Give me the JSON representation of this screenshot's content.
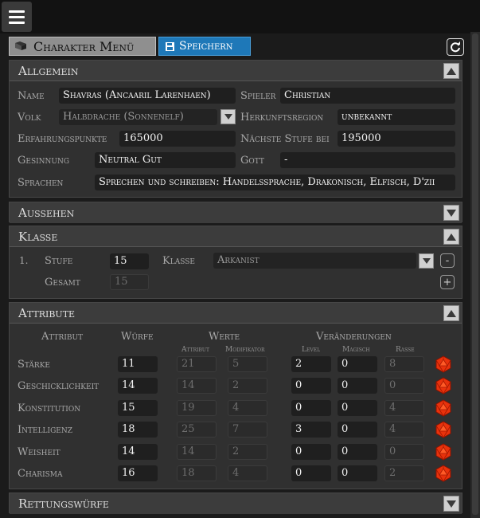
{
  "toolbar": {
    "menu_label": "Charakter Menü",
    "save_label": "Speichern",
    "menu_icon": "book-icon",
    "save_icon": "floppy-disk-icon",
    "refresh_icon": "refresh-icon"
  },
  "allgemein": {
    "title": "Allgemein",
    "name_label": "Name",
    "name_value": "Shavras (Ancaaril Larenhaen)",
    "spieler_label": "Spieler",
    "spieler_value": "Christian",
    "volk_label": "Volk",
    "volk_value": "Halbdrache (Sonnenelf)",
    "herkunft_label": "Herkunftsregion",
    "herkunft_value": "unbekannt",
    "ep_label": "Erfahrungspunkte",
    "ep_value": "165000",
    "next_label": "Nächste Stufe bei",
    "next_value": "195000",
    "gesinnung_label": "Gesinnung",
    "gesinnung_value": "Neutral Gut",
    "gott_label": "Gott",
    "gott_value": "-",
    "sprachen_label": "Sprachen",
    "sprachen_value": "Sprechen und schreiben: Handelssprache, Drakonisch, Elfisch, D'zii"
  },
  "aussehen": {
    "title": "Aussehen"
  },
  "klasse": {
    "title": "Klasse",
    "row_number": "1.",
    "stufe_label": "Stufe",
    "stufe_value": "15",
    "klasse_label": "Klasse",
    "klasse_value": "Arkanist",
    "gesamt_label": "Gesamt",
    "gesamt_value": "15",
    "remove_label": "-",
    "add_label": "+"
  },
  "attribute": {
    "title": "Attribute",
    "headers": {
      "attribut": "Attribut",
      "wuerfe": "Würfe",
      "werte": "Werte",
      "veraenderungen": "Veränderungen"
    },
    "subheaders": {
      "attribut": "Attribut",
      "modifikator": "Modifikator",
      "level": "Level",
      "magisch": "Magisch",
      "rasse": "Rasse"
    },
    "die_icon": "red-d20-die-icon",
    "rows": [
      {
        "name": "Stärke",
        "wuerfe": "11",
        "attribut": "21",
        "modifikator": "5",
        "level": "2",
        "magisch": "0",
        "rasse": "8"
      },
      {
        "name": "Geschicklichkeit",
        "wuerfe": "14",
        "attribut": "14",
        "modifikator": "2",
        "level": "0",
        "magisch": "0",
        "rasse": "0"
      },
      {
        "name": "Konstitution",
        "wuerfe": "15",
        "attribut": "19",
        "modifikator": "4",
        "level": "0",
        "magisch": "0",
        "rasse": "4"
      },
      {
        "name": "Intelligenz",
        "wuerfe": "18",
        "attribut": "25",
        "modifikator": "7",
        "level": "3",
        "magisch": "0",
        "rasse": "4"
      },
      {
        "name": "Weisheit",
        "wuerfe": "14",
        "attribut": "14",
        "modifikator": "2",
        "level": "0",
        "magisch": "0",
        "rasse": "0"
      },
      {
        "name": "Charisma",
        "wuerfe": "16",
        "attribut": "18",
        "modifikator": "4",
        "level": "0",
        "magisch": "0",
        "rasse": "2"
      }
    ]
  },
  "rettungswuerfe": {
    "title": "Rettungswürfe"
  }
}
